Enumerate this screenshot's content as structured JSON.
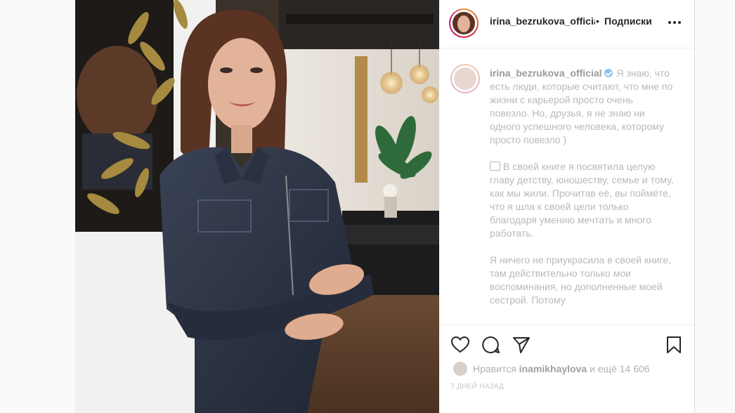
{
  "post": {
    "username": "irina_bezrukova_officia",
    "separator": "•",
    "follow_label": "Подписки",
    "more_icon": "more-horizontal-icon"
  },
  "caption": {
    "username": "irina_bezrukova_official",
    "paragraphs": [
      "Я знаю, что есть люди, которые считают, что мне по жизни с карьерой просто очень повезло. Но, друзья, я не знаю ни одного успешного человека, которому просто повезло )",
      "В своей книге я посвятила целую главу детству, юношеству, семье и тому, как мы жили. Прочитав её, вы поймёте, что я шла к своей цели только благодаря умению мечтать и много работать.",
      "Я ничего не приукрасила в своей книге, там действительно только мои воспоминания, но дополненные моей сестрой. Потому"
    ]
  },
  "actions": {
    "like_icon": "heart-icon",
    "comment_icon": "comment-icon",
    "share_icon": "share-icon",
    "save_icon": "bookmark-icon",
    "likes_prefix": "Нравится",
    "likes_user": "inamikhaylova",
    "likes_suffix": "и ещё 14 606",
    "timestamp": "7 ДНЕЙ НАЗАД"
  },
  "colors": {
    "text": "#262626",
    "faded_text": "#b9b9b9",
    "border": "#efefef",
    "verified": "#3897f0"
  }
}
